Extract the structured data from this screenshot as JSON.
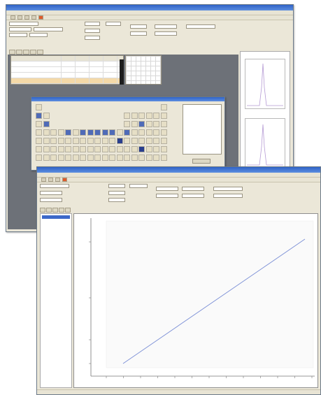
{
  "back_window": {
    "title": "",
    "menu": [
      "",
      "",
      "",
      "",
      ""
    ],
    "sample_table": {
      "headers": [
        "",
        "",
        "",
        "",
        "",
        ""
      ],
      "rows": [
        [
          "",
          "",
          "",
          "",
          ""
        ],
        [
          "",
          "",
          "",
          "",
          ""
        ],
        [
          "",
          "",
          "",
          "",
          ""
        ],
        [
          "",
          "",
          "",
          "",
          ""
        ]
      ]
    },
    "spectrum_panels": [
      {
        "title": ""
      },
      {
        "title": ""
      }
    ]
  },
  "periodic_window": {
    "title": ""
  },
  "front_window": {
    "title": "",
    "menu": [
      "",
      "",
      "",
      "",
      ""
    ],
    "tabs": [
      "",
      "",
      "",
      "",
      ""
    ],
    "list_items": [
      ""
    ],
    "calibration_chart": {
      "chart_data": {
        "type": "line",
        "title": "",
        "xlabel": "",
        "ylabel": "",
        "series": [
          {
            "name": "",
            "x": [
              0,
              1
            ],
            "y": [
              0,
              1
            ]
          }
        ]
      }
    }
  },
  "colors": {
    "title_bar": "#2f63c8",
    "window_bg": "#ebe7d8",
    "workspace_grey": "#6d7178",
    "selected_cell": "#2a3f8e",
    "plot_line": "#7b8fd6",
    "peak_line": "#b59ad4"
  }
}
